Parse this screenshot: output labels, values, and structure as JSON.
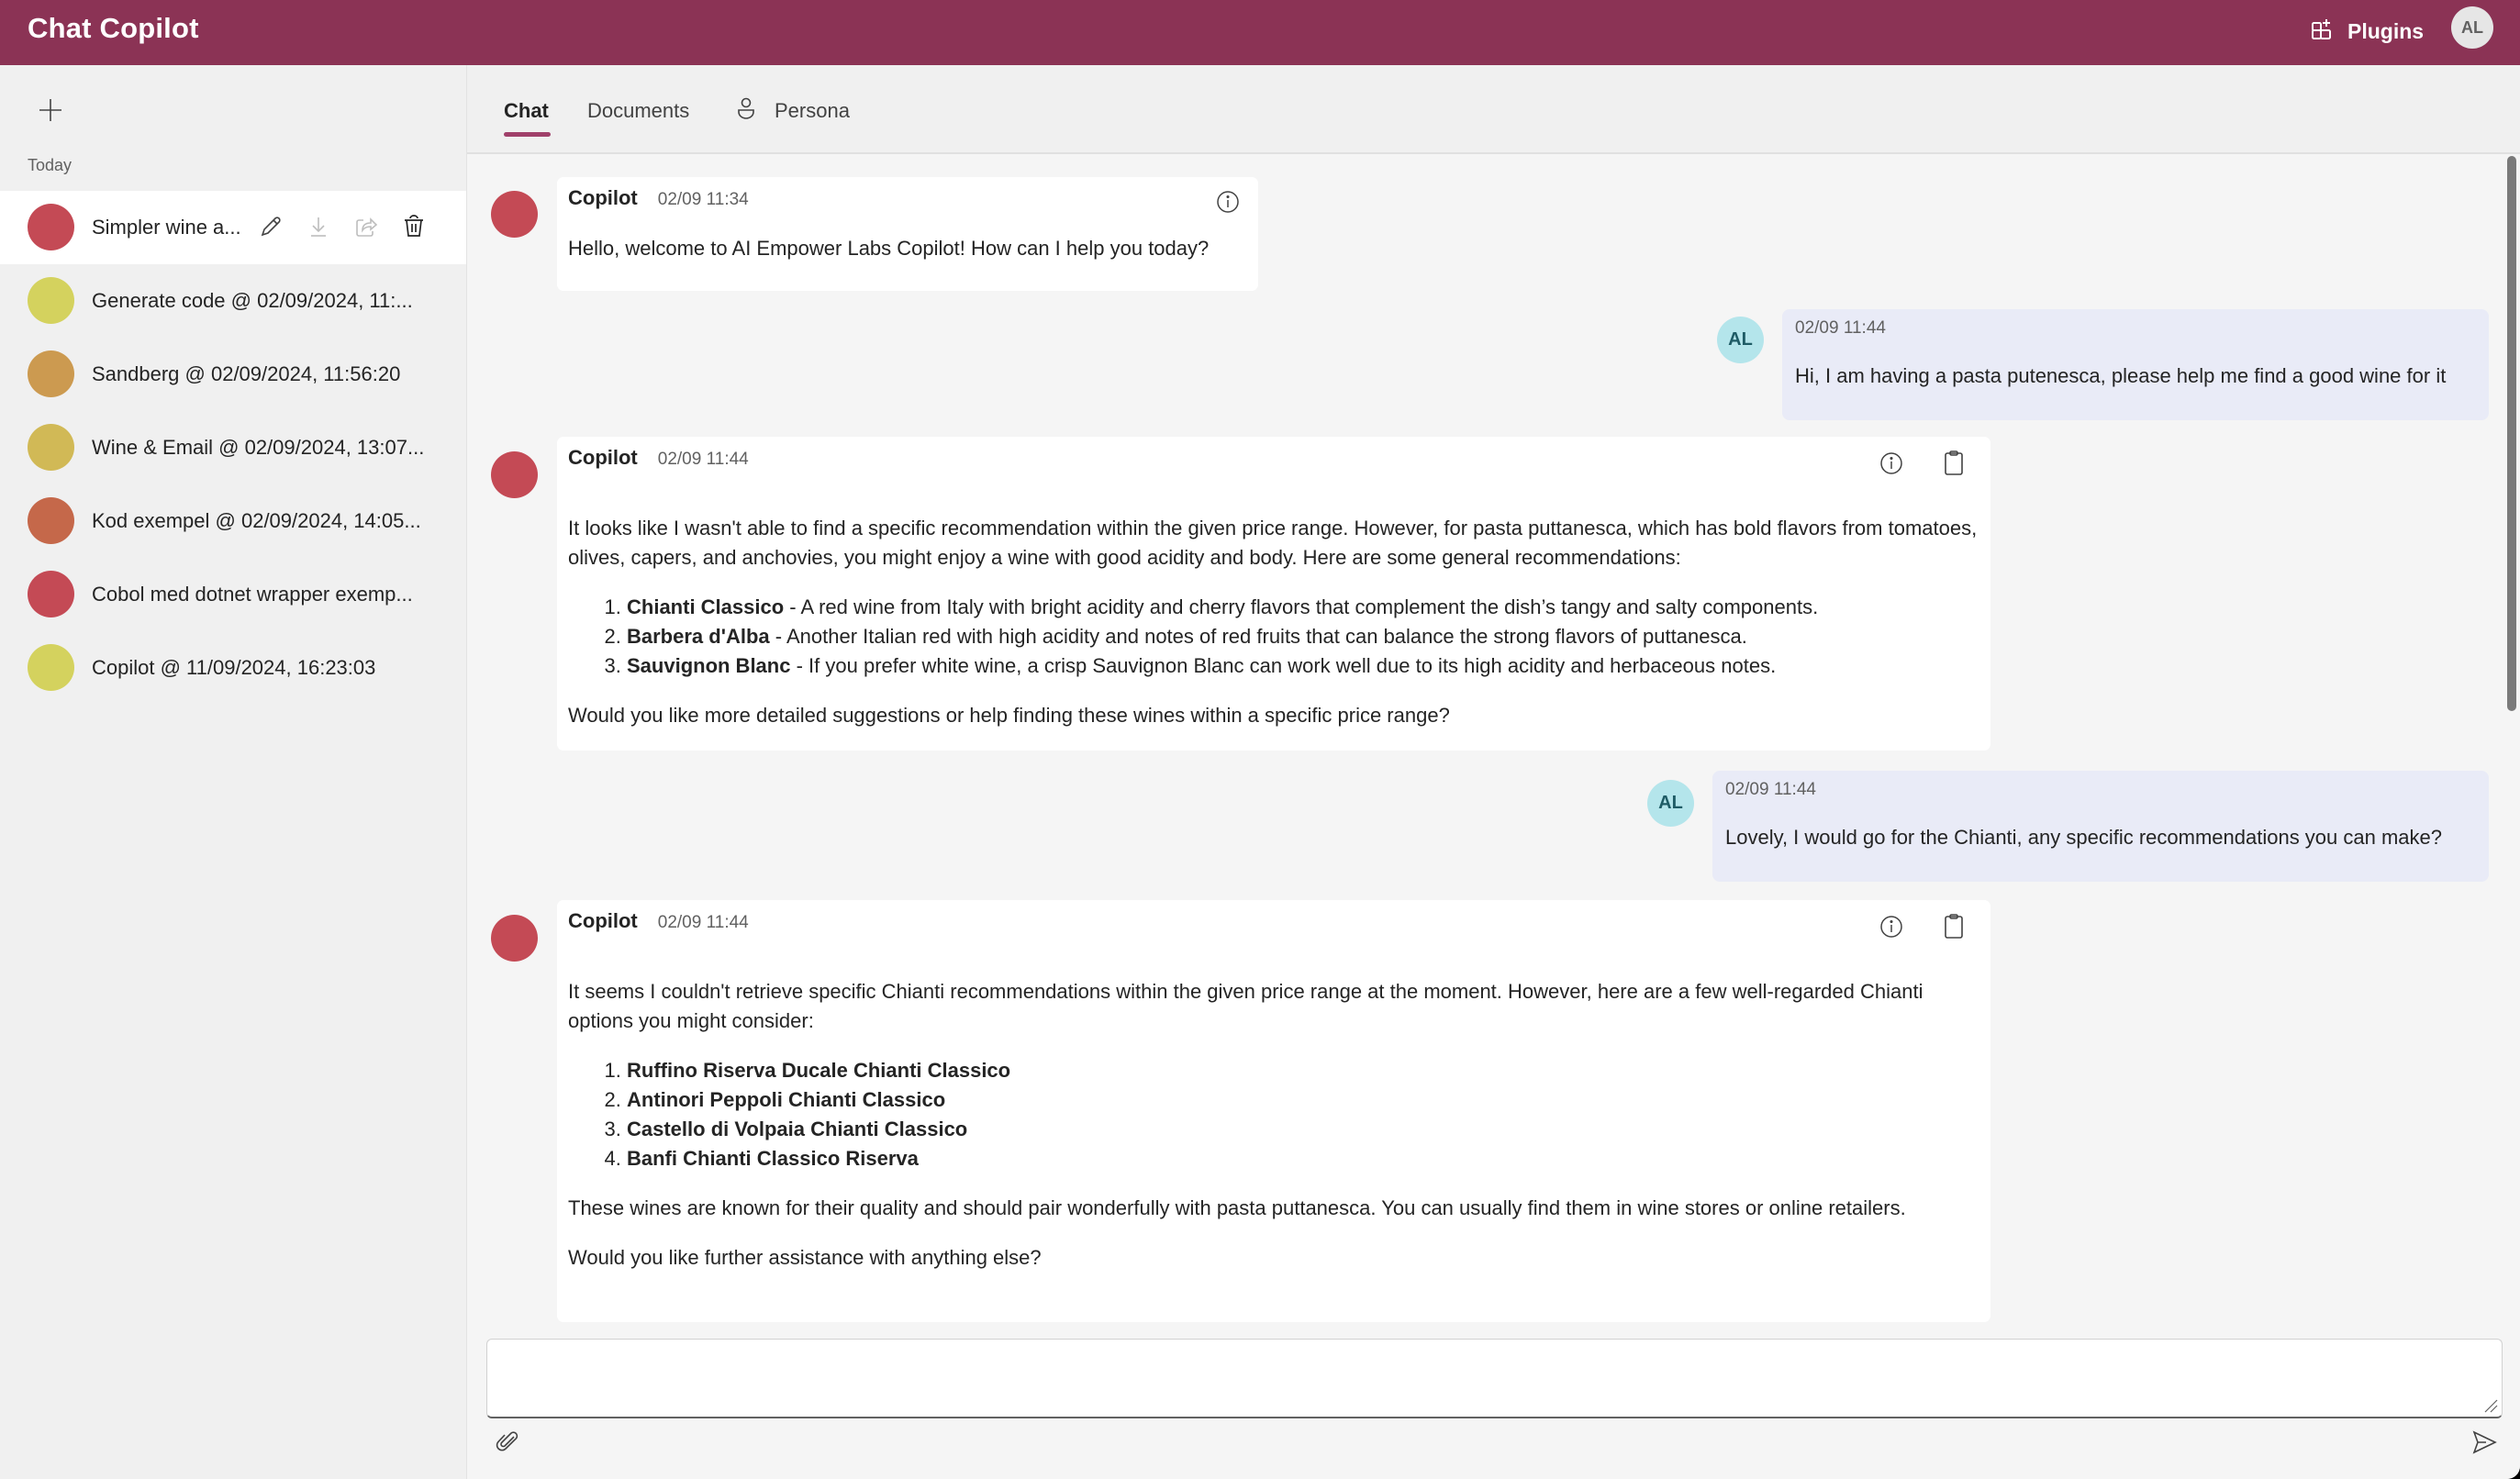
{
  "header": {
    "title": "Chat Copilot",
    "plugins_label": "Plugins",
    "user_initials": "AL",
    "brand_color": "#8B3355"
  },
  "sidebar": {
    "section_label": "Today",
    "items": [
      {
        "title": "Simpler wine a...",
        "color": "#C44A55",
        "selected": true
      },
      {
        "title": "Generate code @ 02/09/2024, 11:...",
        "color": "#D4D25E",
        "selected": false
      },
      {
        "title": "Sandberg @ 02/09/2024, 11:56:20",
        "color": "#CC9A50",
        "selected": false
      },
      {
        "title": "Wine & Email @ 02/09/2024, 13:07...",
        "color": "#D1B956",
        "selected": false
      },
      {
        "title": "Kod exempel @ 02/09/2024, 14:05...",
        "color": "#C5684A",
        "selected": false
      },
      {
        "title": "Cobol med dotnet wrapper exemp...",
        "color": "#C44A55",
        "selected": false
      },
      {
        "title": "Copilot @ 11/09/2024, 16:23:03",
        "color": "#D4D25E",
        "selected": false
      }
    ],
    "item_actions": [
      "edit-icon",
      "download-icon",
      "share-icon",
      "delete-icon"
    ]
  },
  "tabs": [
    {
      "label": "Chat",
      "active": true
    },
    {
      "label": "Documents",
      "active": false
    },
    {
      "label": "Persona",
      "active": false,
      "icon": "person-icon"
    }
  ],
  "messages": [
    {
      "sender": "Copilot",
      "time": "02/09 11:34",
      "type": "bot",
      "paragraphs": [
        "Hello, welcome to AI Empower Labs Copilot! How can I help you today?"
      ]
    },
    {
      "sender": "AL",
      "time": "02/09 11:44",
      "type": "user",
      "text": "Hi, I am having a pasta putenesca, please help me find a good wine for it"
    },
    {
      "sender": "Copilot",
      "time": "02/09 11:44",
      "type": "bot",
      "intro": "It looks like I wasn't able to find a specific recommendation within the given price range. However, for pasta puttanesca, which has bold flavors from tomatoes, olives, capers, and anchovies, you might enjoy a wine with good acidity and body. Here are some general recommendations:",
      "list": [
        {
          "bold": "Chianti Classico",
          "rest": " - A red wine from Italy with bright acidity and cherry flavors that complement the dish’s tangy and salty components."
        },
        {
          "bold": "Barbera d'Alba",
          "rest": " - Another Italian red with high acidity and notes of red fruits that can balance the strong flavors of puttanesca."
        },
        {
          "bold": "Sauvignon Blanc",
          "rest": " - If you prefer white wine, a crisp Sauvignon Blanc can work well due to its high acidity and herbaceous notes."
        }
      ],
      "outro": "Would you like more detailed suggestions or help finding these wines within a specific price range?"
    },
    {
      "sender": "AL",
      "time": "02/09 11:44",
      "type": "user",
      "text": "Lovely, I would go for the Chianti, any specific recommendations you can make?"
    },
    {
      "sender": "Copilot",
      "time": "02/09 11:44",
      "type": "bot",
      "intro": "It seems I couldn't retrieve specific Chianti recommendations within the given price range at the moment. However, here are a few well-regarded Chianti options you might consider:",
      "list": [
        {
          "bold": "Ruffino Riserva Ducale Chianti Classico",
          "rest": ""
        },
        {
          "bold": "Antinori Peppoli Chianti Classico",
          "rest": ""
        },
        {
          "bold": "Castello di Volpaia Chianti Classico",
          "rest": ""
        },
        {
          "bold": "Banfi Chianti Classico Riserva",
          "rest": ""
        }
      ],
      "outro": "These wines are known for their quality and should pair wonderfully with pasta puttanesca. You can usually find them in wine stores or online retailers.",
      "outro2": "Would you like further assistance with anything else?"
    }
  ],
  "composer": {
    "value": "",
    "placeholder": ""
  }
}
